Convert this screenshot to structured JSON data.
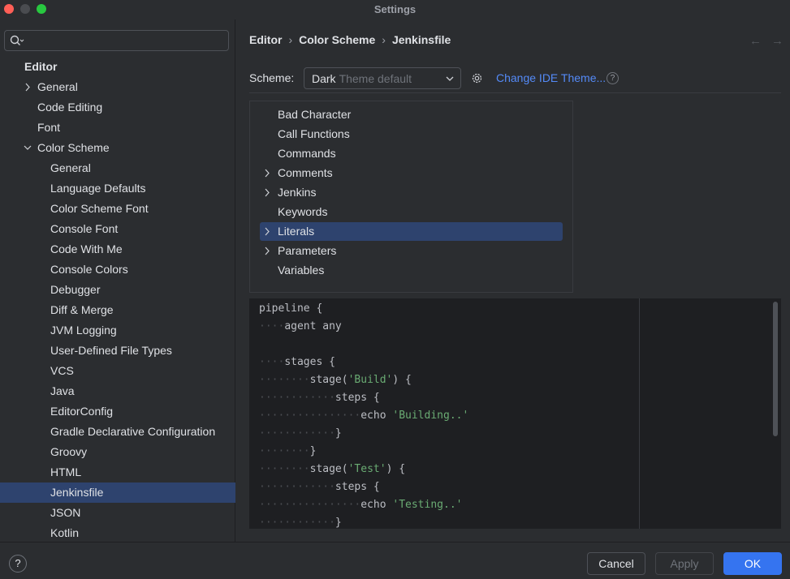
{
  "window": {
    "title": "Settings"
  },
  "sidebar": {
    "search_placeholder": "",
    "items": [
      {
        "label": "Editor",
        "level": 0,
        "bold": true
      },
      {
        "label": "General",
        "level": 1,
        "chevron": "right"
      },
      {
        "label": "Code Editing",
        "level": 1
      },
      {
        "label": "Font",
        "level": 1
      },
      {
        "label": "Color Scheme",
        "level": 1,
        "chevron": "down"
      },
      {
        "label": "General",
        "level": 2
      },
      {
        "label": "Language Defaults",
        "level": 2
      },
      {
        "label": "Color Scheme Font",
        "level": 2
      },
      {
        "label": "Console Font",
        "level": 2
      },
      {
        "label": "Code With Me",
        "level": 2
      },
      {
        "label": "Console Colors",
        "level": 2
      },
      {
        "label": "Debugger",
        "level": 2
      },
      {
        "label": "Diff & Merge",
        "level": 2
      },
      {
        "label": "JVM Logging",
        "level": 2
      },
      {
        "label": "User-Defined File Types",
        "level": 2
      },
      {
        "label": "VCS",
        "level": 2
      },
      {
        "label": "Java",
        "level": 2
      },
      {
        "label": "EditorConfig",
        "level": 2
      },
      {
        "label": "Gradle Declarative Configuration",
        "level": 2
      },
      {
        "label": "Groovy",
        "level": 2
      },
      {
        "label": "HTML",
        "level": 2
      },
      {
        "label": "Jenkinsfile",
        "level": 2,
        "selected": true
      },
      {
        "label": "JSON",
        "level": 2
      },
      {
        "label": "Kotlin",
        "level": 2
      }
    ]
  },
  "breadcrumb": [
    "Editor",
    "Color Scheme",
    "Jenkinsfile"
  ],
  "scheme": {
    "label": "Scheme:",
    "value": "Dark",
    "hint": "Theme default",
    "change_link": "Change IDE Theme...",
    "help": "?"
  },
  "attributes": [
    {
      "label": "Bad Character",
      "expandable": false
    },
    {
      "label": "Call Functions",
      "expandable": false
    },
    {
      "label": "Commands",
      "expandable": false
    },
    {
      "label": "Comments",
      "expandable": true
    },
    {
      "label": "Jenkins",
      "expandable": true
    },
    {
      "label": "Keywords",
      "expandable": false
    },
    {
      "label": "Literals",
      "expandable": true,
      "selected": true
    },
    {
      "label": "Parameters",
      "expandable": true
    },
    {
      "label": "Variables",
      "expandable": false
    }
  ],
  "preview": {
    "lines": [
      [
        {
          "t": "pipeline {"
        }
      ],
      [
        {
          "t": "····",
          "k": "ws"
        },
        {
          "t": "agent any"
        }
      ],
      [],
      [
        {
          "t": "····",
          "k": "ws"
        },
        {
          "t": "stages {"
        }
      ],
      [
        {
          "t": "········",
          "k": "ws"
        },
        {
          "t": "stage("
        },
        {
          "t": "'Build'",
          "k": "str"
        },
        {
          "t": ") {"
        }
      ],
      [
        {
          "t": "············",
          "k": "ws"
        },
        {
          "t": "steps {"
        }
      ],
      [
        {
          "t": "················",
          "k": "ws"
        },
        {
          "t": "echo "
        },
        {
          "t": "'Building..'",
          "k": "str"
        }
      ],
      [
        {
          "t": "············",
          "k": "ws"
        },
        {
          "t": "}"
        }
      ],
      [
        {
          "t": "········",
          "k": "ws"
        },
        {
          "t": "}"
        }
      ],
      [
        {
          "t": "········",
          "k": "ws"
        },
        {
          "t": "stage("
        },
        {
          "t": "'Test'",
          "k": "str"
        },
        {
          "t": ") {"
        }
      ],
      [
        {
          "t": "············",
          "k": "ws"
        },
        {
          "t": "steps {"
        }
      ],
      [
        {
          "t": "················",
          "k": "ws"
        },
        {
          "t": "echo "
        },
        {
          "t": "'Testing..'",
          "k": "str"
        }
      ],
      [
        {
          "t": "············",
          "k": "ws"
        },
        {
          "t": "}"
        }
      ]
    ]
  },
  "footer": {
    "help": "?",
    "cancel": "Cancel",
    "apply": "Apply",
    "ok": "OK"
  },
  "colors": {
    "background": "#2b2d30",
    "editor_background": "#1e1f22",
    "selection": "#2e436e",
    "accent": "#3574f0",
    "link": "#548af7",
    "string": "#6aab73"
  }
}
